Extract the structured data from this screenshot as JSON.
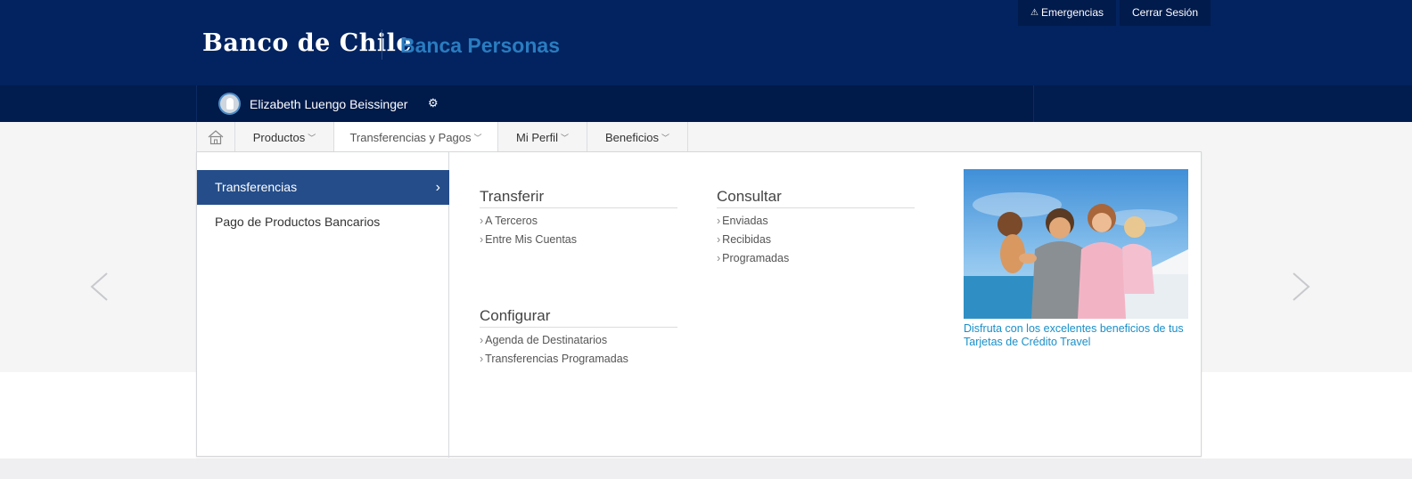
{
  "header": {
    "top_links": [
      {
        "icon": "warning-icon",
        "label": "Emergencias"
      },
      {
        "label": "Cerrar Sesión"
      }
    ],
    "logo_text": "Banco de Chile",
    "site_title": "Banca Personas",
    "user_name": "Elizabeth Luengo Beissinger"
  },
  "nav": {
    "items": [
      {
        "label": "Productos"
      },
      {
        "label": "Transferencias y Pagos"
      },
      {
        "label": "Mi Perfil"
      },
      {
        "label": "Beneficios"
      }
    ]
  },
  "panel": {
    "left_items": [
      {
        "label": "Transferencias",
        "active": true
      },
      {
        "label": "Pago de Productos Bancarios"
      }
    ],
    "groups": [
      {
        "title": "Transferir",
        "links": [
          "A Terceros",
          "Entre Mis Cuentas"
        ]
      },
      {
        "title": "Consultar",
        "links": [
          "Enviadas",
          "Recibidas",
          "Programadas"
        ]
      },
      {
        "title": "Configurar",
        "links": [
          "Agenda de Destinatarios",
          "Transferencias Programadas"
        ]
      }
    ],
    "promo_text": "Disfruta con los excelentes beneficios de tus Tarjetas de Crédito Travel"
  },
  "colors": {
    "header_bg": "#02235f",
    "active_menu_bg": "#244d8a",
    "accent_link": "#1a8fc8"
  }
}
